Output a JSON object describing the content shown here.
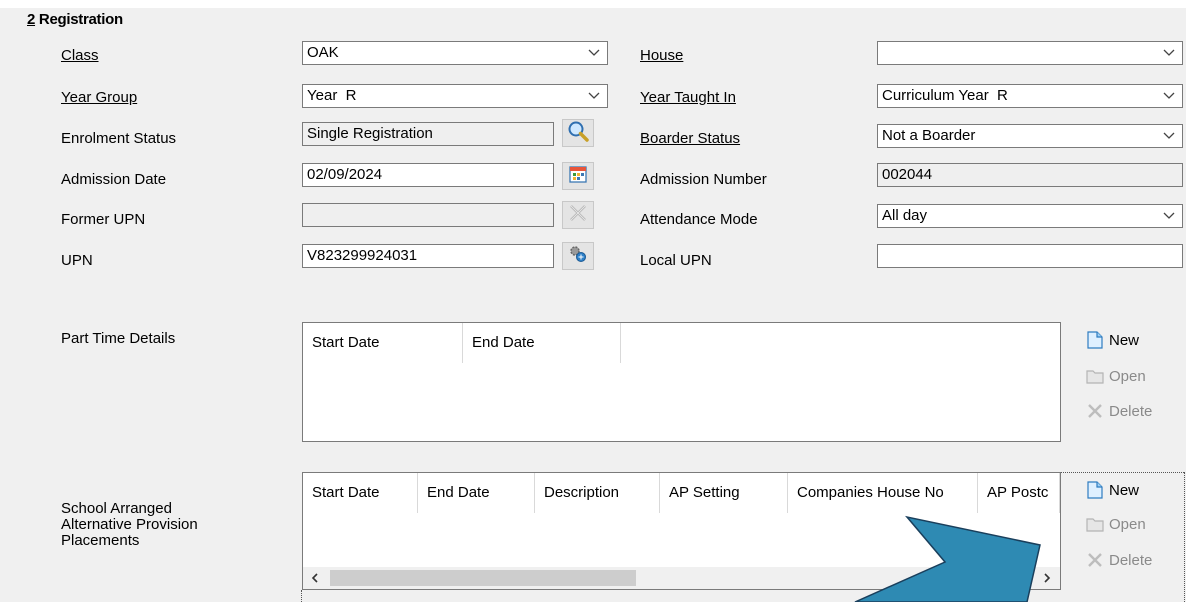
{
  "section": {
    "number": "2",
    "title": " Registration"
  },
  "left_fields": {
    "class": {
      "label": "Class",
      "value": "OAK"
    },
    "year_group": {
      "label": "Year Group",
      "value": "Year  R"
    },
    "enrolment_status": {
      "label": "Enrolment Status",
      "value": "Single Registration"
    },
    "admission_date": {
      "label": "Admission Date",
      "value": "02/09/2024"
    },
    "former_upn": {
      "label": "Former UPN",
      "value": ""
    },
    "upn": {
      "label": "UPN",
      "value": "V823299924031"
    }
  },
  "right_fields": {
    "house": {
      "label": "House",
      "value": ""
    },
    "year_taught_in": {
      "label": "Year Taught In",
      "value": "Curriculum Year  R"
    },
    "boarder_status": {
      "label": "Boarder Status",
      "value": "Not a Boarder"
    },
    "admission_number": {
      "label": "Admission Number",
      "value": "002044"
    },
    "attendance_mode": {
      "label": "Attendance Mode",
      "value": "All day"
    },
    "local_upn": {
      "label": "Local UPN",
      "value": ""
    }
  },
  "part_time": {
    "label": "Part Time Details",
    "columns": [
      "Start Date",
      "End Date"
    ],
    "actions": {
      "new": "New",
      "open": "Open",
      "delete": "Delete"
    }
  },
  "ap_placements": {
    "label_line1": "School Arranged",
    "label_line2": "Alternative Provision",
    "label_line3": "Placements",
    "columns": [
      "Start Date",
      "End Date",
      "Description",
      "AP Setting",
      "Companies House No",
      "AP Postc"
    ],
    "actions": {
      "new": "New",
      "open": "Open",
      "delete": "Delete"
    }
  },
  "colors": {
    "annotation_arrow": "#2e8ab3",
    "arrow_outline": "#1a3f5c",
    "panel_bg": "#f0f0f0"
  }
}
